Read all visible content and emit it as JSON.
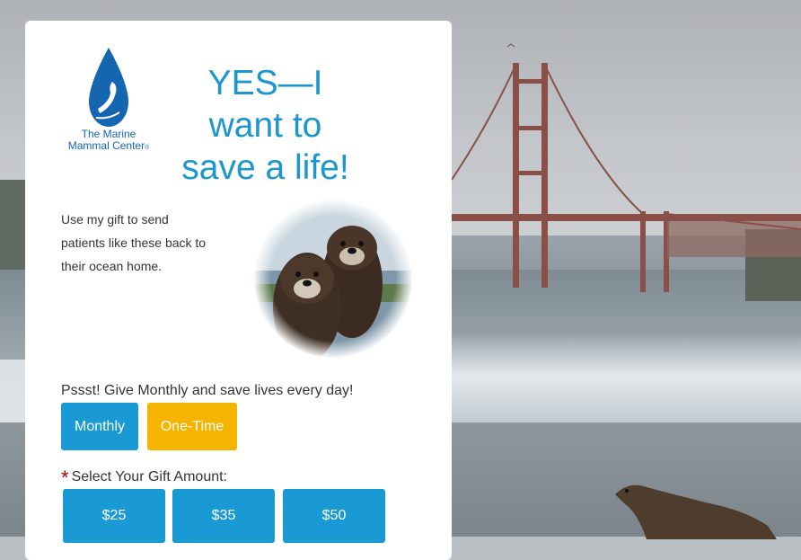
{
  "logo": {
    "line1": "The Marine",
    "line2": "Mammal Center",
    "mark": "®"
  },
  "headline": {
    "line1": "YES—I",
    "line2": "want to",
    "line3": "save a life!"
  },
  "intro": {
    "line1": "Use my gift to send",
    "line2": "patients like these back to",
    "line3": "their ocean home."
  },
  "promo_text": "Pssst! Give Monthly and save lives every day!",
  "frequency": {
    "monthly_label": "Monthly",
    "one_time_label": "One-Time"
  },
  "amount": {
    "required_mark": "*",
    "label": "Select Your Gift Amount:",
    "options": [
      "$25",
      "$35",
      "$50"
    ]
  },
  "colors": {
    "brand_blue": "#1a9ad4",
    "accent_yellow": "#f5b400",
    "required_red": "#b20000"
  }
}
